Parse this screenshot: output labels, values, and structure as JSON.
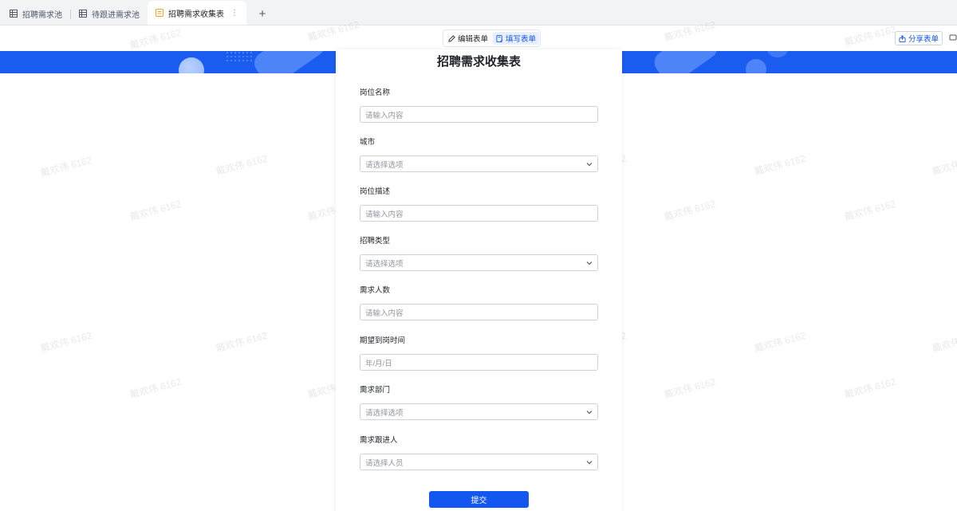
{
  "tabs": [
    {
      "label": "招聘需求池",
      "icon": "table-icon",
      "active": false
    },
    {
      "label": "待跟进需求池",
      "icon": "table-icon",
      "active": false
    },
    {
      "label": "招聘需求收集表",
      "icon": "form-icon",
      "active": true
    }
  ],
  "toolbar": {
    "edit_form_label": "编辑表单",
    "fill_form_label": "填写表单",
    "share_form_label": "分享表单"
  },
  "form": {
    "title": "招聘需求收集表",
    "fields": [
      {
        "label": "岗位名称",
        "placeholder": "请输入内容",
        "type": "text"
      },
      {
        "label": "城市",
        "placeholder": "请选择选项",
        "type": "select"
      },
      {
        "label": "岗位描述",
        "placeholder": "请输入内容",
        "type": "text"
      },
      {
        "label": "招聘类型",
        "placeholder": "请选择选项",
        "type": "select"
      },
      {
        "label": "需求人数",
        "placeholder": "请输入内容",
        "type": "text"
      },
      {
        "label": "期望到岗时间",
        "placeholder": "年/月/日",
        "type": "date"
      },
      {
        "label": "需求部门",
        "placeholder": "请选择选项",
        "type": "select"
      },
      {
        "label": "需求跟进人",
        "placeholder": "请选择人员",
        "type": "select"
      }
    ],
    "submit_label": "提交"
  },
  "watermark_text": "戴欢伟 6162",
  "colors": {
    "accent": "#1456f0",
    "banner": "#1a5cf0"
  }
}
